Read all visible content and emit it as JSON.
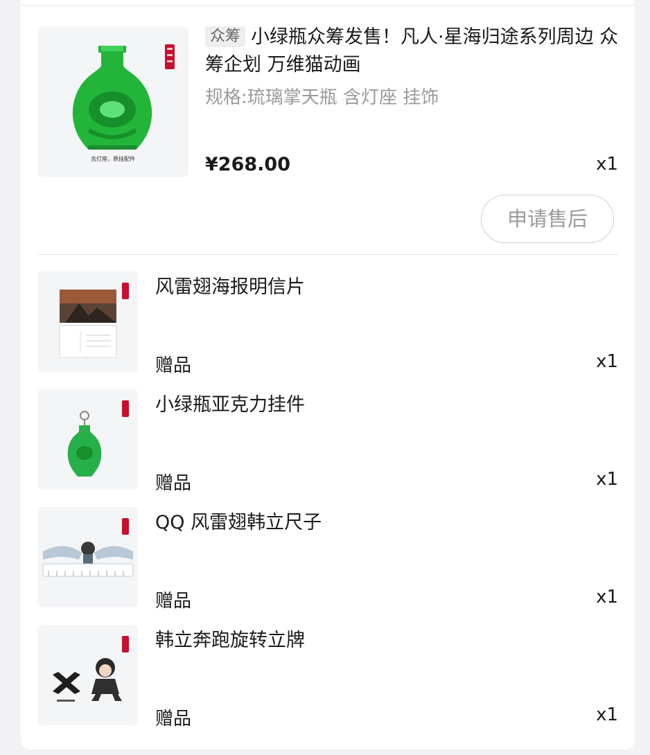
{
  "main_product": {
    "tag": "众筹",
    "title": "小绿瓶众筹发售！凡人·星海归途系列周边 众筹企划 万维猫动画",
    "spec": "规格:琉璃掌天瓶 含灯座 挂饰",
    "price": "¥268.00",
    "quantity": "x1",
    "thumb_caption": "含灯座，悬挂配件",
    "after_sale_label": "申请售后"
  },
  "gifts": [
    {
      "title": "风雷翅海报明信片",
      "label": "赠品",
      "quantity": "x1",
      "icon": "postcard-image"
    },
    {
      "title": "小绿瓶亚克力挂件",
      "label": "赠品",
      "quantity": "x1",
      "icon": "acrylic-keychain-image"
    },
    {
      "title": "QQ 风雷翅韩立尺子",
      "label": "赠品",
      "quantity": "x1",
      "icon": "ruler-image"
    },
    {
      "title": "韩立奔跑旋转立牌",
      "label": "赠品",
      "quantity": "x1",
      "icon": "standee-image"
    }
  ],
  "colors": {
    "bottle_green": "#22b53a",
    "seal_red": "#c8102e",
    "border": "#cfcfcf"
  }
}
